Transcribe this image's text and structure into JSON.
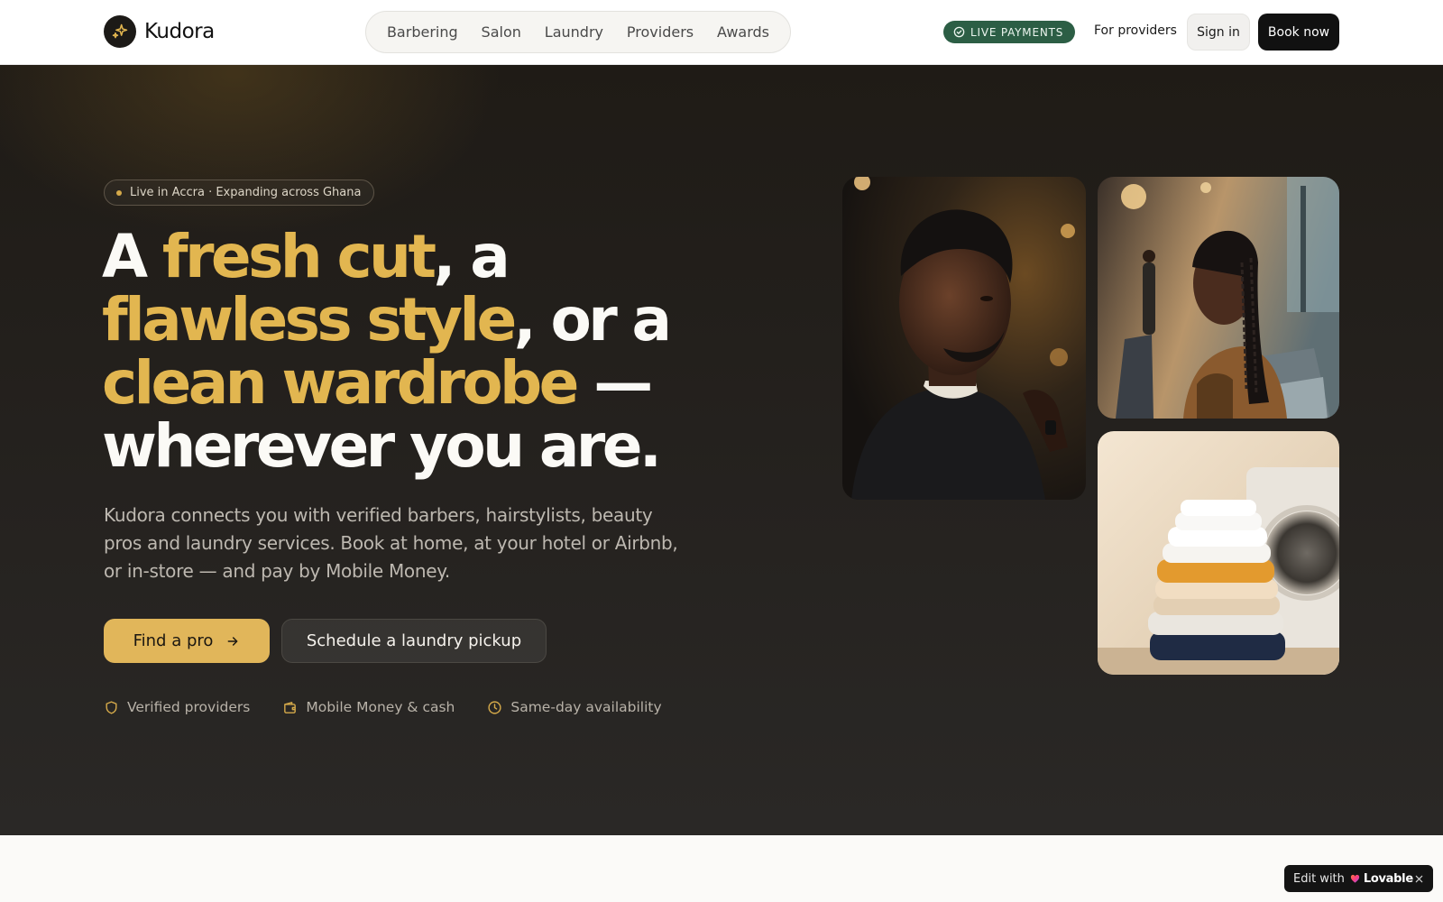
{
  "brand": {
    "name": "Kudora"
  },
  "nav": {
    "links": [
      "Barbering",
      "Salon",
      "Laundry",
      "Providers",
      "Awards"
    ],
    "live_badge": "LIVE PAYMENTS",
    "for_providers": "For providers",
    "sign_in": "Sign in",
    "book_now": "Book now"
  },
  "hero": {
    "location_chip": "Live in Accra · Expanding across Ghana",
    "headline": {
      "p1": "A ",
      "g1": "fresh cut",
      "p2": ", a",
      "g2": "flawless style",
      "p3": ", or a",
      "g3": "clean wardrobe",
      "p4": " —",
      "p5": "wherever you are."
    },
    "subcopy": "Kudora connects you with verified barbers, hairstylists, beauty pros and laundry services. Book at home, at your hotel or Airbnb, or in-store — and pay by Mobile Money.",
    "cta_primary": "Find a pro",
    "cta_secondary": "Schedule a laundry pickup",
    "features": [
      "Verified providers",
      "Mobile Money & cash",
      "Same-day availability"
    ]
  },
  "badge": {
    "prefix": "Edit with",
    "brand": "Lovable"
  },
  "colors": {
    "accent_gold": "#e2b650",
    "hero_bg": "#25221f",
    "live_badge_bg": "#2c5e45",
    "primary_button": "#e1b65a"
  },
  "icons": {
    "logo": "sparkle-icon",
    "live": "check-circle-icon",
    "cta": "arrow-right-icon",
    "features": [
      "shield-icon",
      "wallet-icon",
      "clock-icon"
    ],
    "close": "close-icon"
  }
}
